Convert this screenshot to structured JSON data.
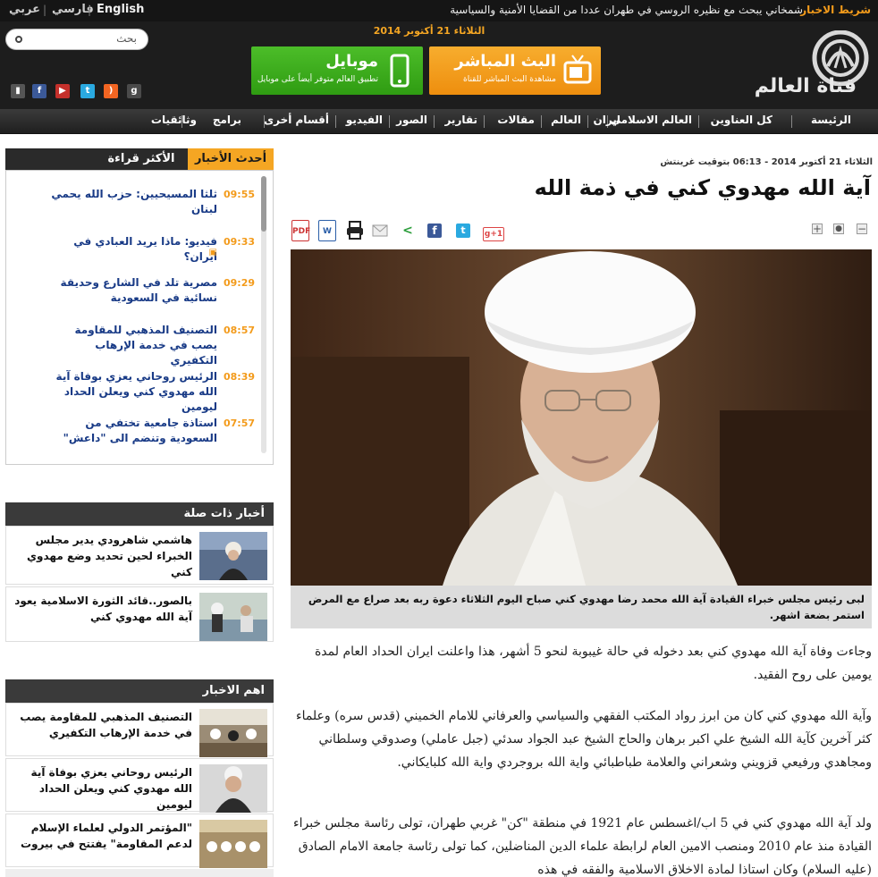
{
  "ticker": {
    "label": "شريط الاخبار",
    "text": "شمخاني يبحث مع نظيره الروسي في طهران عددا من القضايا الأمنية والسياسية",
    "languages": [
      "English",
      "فارسي",
      "عربي"
    ]
  },
  "header": {
    "site_name": "قناة العالم",
    "date": "الثلاثاء 21 أكتوبر 2014",
    "live_title": "البث المباشر",
    "live_sub": "مشاهدة البث المباشر للقناة",
    "mobile_title": "موبايل",
    "mobile_sub": "تطبيق العالم متوفر أيضاً على موبايل",
    "search_placeholder": "بحث",
    "social": [
      "mobile-icon",
      "facebook-icon",
      "youtube-icon",
      "twitter-icon",
      "rss-icon",
      "google-plus-icon"
    ]
  },
  "nav": [
    "الرئيسة",
    "كل العناوين",
    "العالم الاسلامي",
    "ايران",
    "العالم",
    "مقالات",
    "تقارير",
    "الصور",
    "الفيديو",
    "أقسام أخرى",
    "برامج",
    "وثائقيات"
  ],
  "sidebar": {
    "tab_latest": "أحدث الأخبار",
    "tab_most_read": "الأكثر قراءة",
    "latest": [
      {
        "time": "09:55",
        "title": "ثلثا المسيحيين: حزب الله يحمي لبنان"
      },
      {
        "time": "09:33",
        "title": "فيديو: ماذا يريد العبادي في ايران؟"
      },
      {
        "time": "09:29",
        "title": "مصرية تلد في الشارع وحديقة نسائية في السعودية"
      },
      {
        "time": "08:57",
        "title": "التصنيف المذهبي للمقاومة يصب في خدمة الإرهاب التكفيري"
      },
      {
        "time": "08:39",
        "title": "الرئيس روحاني يعزي بوفاة آية الله مهدوي كني ويعلن الحداد ليومين"
      },
      {
        "time": "07:57",
        "title": "استاذة جامعية تختفي من السعودية وتنضم الى \"داعش\""
      }
    ],
    "related_title": "أخبار ذات صلة",
    "related": [
      "هاشمي شاهرودي يدير مجلس الخبراء لحين تحديد وضع مهدوي كني",
      "بالصور..قائد الثورة الاسلامية يعود آية الله مهدوي كني"
    ],
    "top_title": "اهم الاخبار",
    "top": [
      "التصنيف المذهبي للمقاومة يصب في خدمة الإرهاب التكفيري",
      "الرئيس روحاني يعزي بوفاة آية الله مهدوي كني ويعلن الحداد ليومين",
      "\"المؤتمر الدولي لعلماء الإسلام لدعم المقاومة\" يفتتح في بيروت"
    ]
  },
  "article": {
    "timestamp": "الثلاثاء 21 أكتوبر 2014 - 06:13 بتوقيت غرينتش",
    "headline": "آية الله مهدوي كني في ذمة الله",
    "gplus_label": "g+1",
    "caption": "لبى رئيس مجلس خبراء القيادة آية الله محمد رضا مهدوي كني صباح اليوم الثلاثاء دعوة ربه بعد صراع مع المرض استمر بضعة اشهر.",
    "paragraphs": [
      "وجاءت وفاة آية الله مهدوي كني بعد دخوله في حالة غيبوبة لنحو 5 أشهر، هذا واعلنت ايران الحداد العام لمدة يومين على روح الفقيد.",
      "وآية الله مهدوي كني كان من ابرز رواد المكتب الفقهي والسياسي والعرفاني للامام الخميني (قدس سره) وعلماء كثر آخرين كآية الله الشيخ علي اكبر برهان والحاج الشيخ عبد الجواد سدئي (جبل عاملي) وصدوقي وسلطاني ومجاهدي ورفيعي قزويني وشعراني والعلامة طباطبائي واية الله بروجردي واية الله كلبايكاني.",
      "ولد آية الله مهدوي كني في 5 اب/اغسطس عام 1921 في منطقة \"كن\" غربي طهران، تولى رئاسة مجلس خبراء القيادة منذ عام 2010 ومنصب الامين العام لرابطة علماء الدين المناضلين، كما تولى رئاسة جامعة الامام الصادق (عليه السلام) وكان استاذا لمادة الاخلاق الاسلامية والفقه في هذه"
    ]
  }
}
